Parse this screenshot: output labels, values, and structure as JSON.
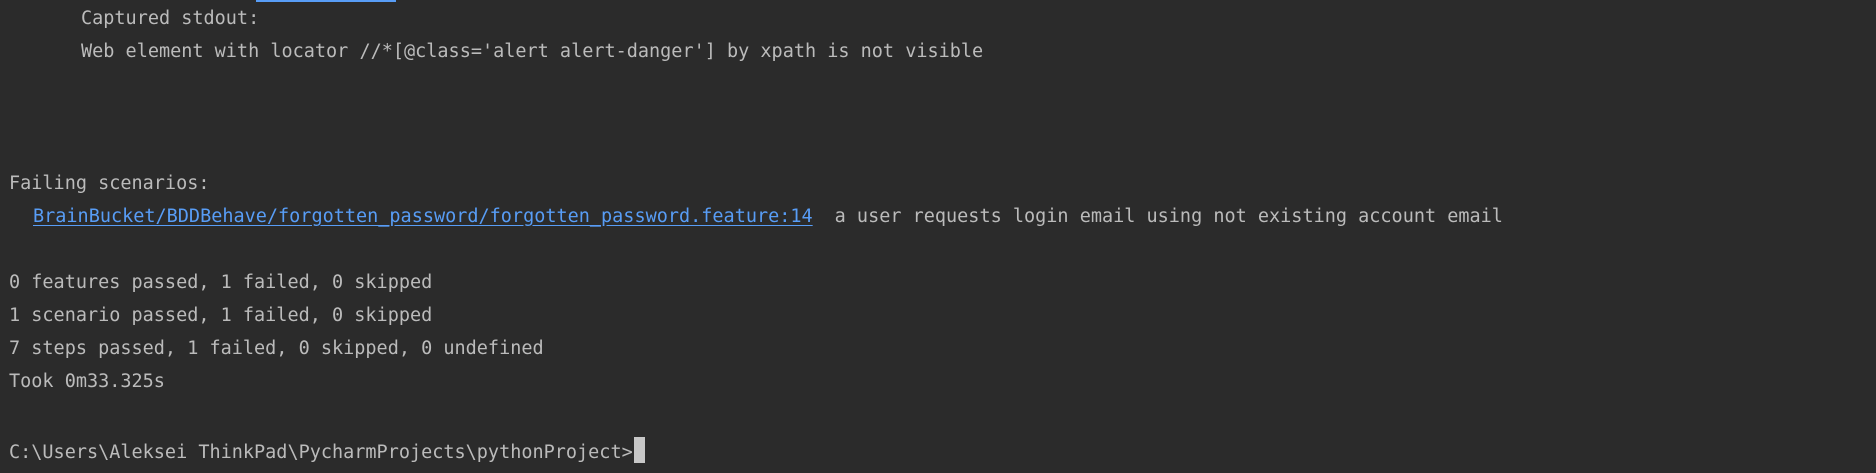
{
  "terminal": {
    "captured_label": "Captured stdout:",
    "captured_message": "Web element with locator //*[@class='alert alert-danger'] by xpath is not visible",
    "failing_header": "Failing scenarios:",
    "failing_link": "BrainBucket/BDDBehave/forgotten_password/forgotten_password.feature:14",
    "failing_scenario_name": "a user requests login email using not existing account email",
    "summary": [
      "0 features passed, 1 failed, 0 skipped",
      "1 scenario passed, 1 failed, 0 skipped",
      "7 steps passed, 1 failed, 0 skipped, 0 undefined"
    ],
    "duration": "Took 0m33.325s",
    "prompt": "C:\\Users\\Aleksei ThinkPad\\PycharmProjects\\pythonProject>"
  }
}
